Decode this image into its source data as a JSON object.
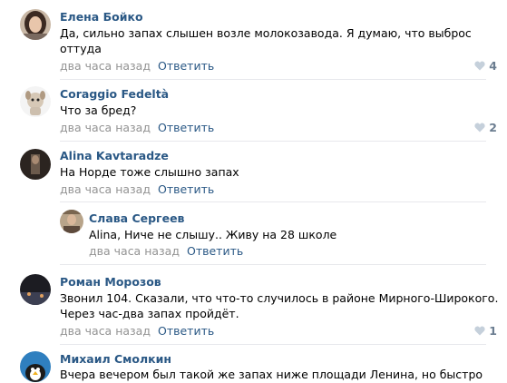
{
  "comments": [
    {
      "author": "Елена Бойко",
      "text_line1": "Да, сильно запах слышен возле молокозавода. Я думаю, что выброс",
      "text_line2": "оттуда",
      "time": "два часа назад",
      "reply": "Ответить",
      "likes": "4"
    },
    {
      "author": "Coraggio Fedeltà",
      "text_line1": "Что за бред?",
      "time": "два часа назад",
      "reply": "Ответить",
      "likes": "2"
    },
    {
      "author": "Alina Kavtaradze",
      "text_line1": "На Норде тоже слышно запах",
      "time": "два часа назад",
      "reply": "Ответить",
      "replies": [
        {
          "author": "Слава Сергеев",
          "text_line1": "Alina, Ниче не слышу.. Живу на 28 школе",
          "time": "два часа назад",
          "reply": "Ответить"
        }
      ]
    },
    {
      "author": "Роман Морозов",
      "text_line1": "Звонил 104. Сказали, что что-то случилось в районе Мирного-Широкого.",
      "text_line2": "Через час-два запах пройдёт.",
      "time": "два часа назад",
      "reply": "Ответить",
      "likes": "1"
    },
    {
      "author": "Михаил Смолкин",
      "text_line1": "Вчера вечером был такой же запах ниже площади Ленина, но быстро"
    }
  ],
  "icons": {
    "like": "heart-icon"
  },
  "colors": {
    "link": "#2a5885",
    "meta": "#939393",
    "like": "#6b7d90",
    "separator": "#e7e8ec"
  }
}
